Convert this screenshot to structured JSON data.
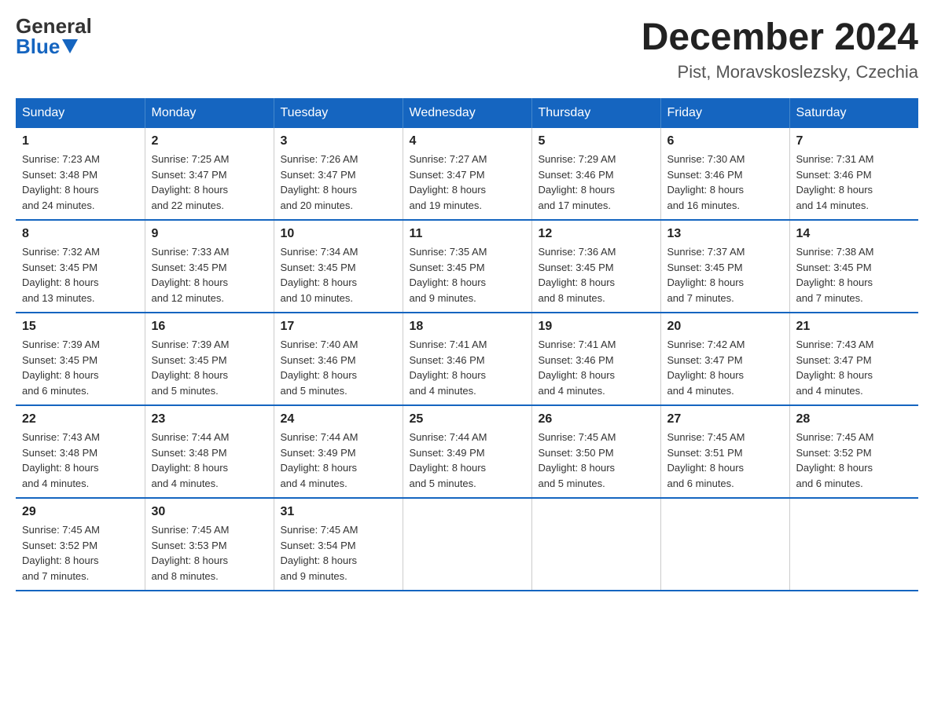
{
  "logo": {
    "general": "General",
    "blue": "Blue"
  },
  "title": {
    "month_year": "December 2024",
    "location": "Pist, Moravskoslezsky, Czechia"
  },
  "headers": [
    "Sunday",
    "Monday",
    "Tuesday",
    "Wednesday",
    "Thursday",
    "Friday",
    "Saturday"
  ],
  "weeks": [
    [
      {
        "day": "1",
        "sunrise": "7:23 AM",
        "sunset": "3:48 PM",
        "daylight": "8 hours and 24 minutes."
      },
      {
        "day": "2",
        "sunrise": "7:25 AM",
        "sunset": "3:47 PM",
        "daylight": "8 hours and 22 minutes."
      },
      {
        "day": "3",
        "sunrise": "7:26 AM",
        "sunset": "3:47 PM",
        "daylight": "8 hours and 20 minutes."
      },
      {
        "day": "4",
        "sunrise": "7:27 AM",
        "sunset": "3:47 PM",
        "daylight": "8 hours and 19 minutes."
      },
      {
        "day": "5",
        "sunrise": "7:29 AM",
        "sunset": "3:46 PM",
        "daylight": "8 hours and 17 minutes."
      },
      {
        "day": "6",
        "sunrise": "7:30 AM",
        "sunset": "3:46 PM",
        "daylight": "8 hours and 16 minutes."
      },
      {
        "day": "7",
        "sunrise": "7:31 AM",
        "sunset": "3:46 PM",
        "daylight": "8 hours and 14 minutes."
      }
    ],
    [
      {
        "day": "8",
        "sunrise": "7:32 AM",
        "sunset": "3:45 PM",
        "daylight": "8 hours and 13 minutes."
      },
      {
        "day": "9",
        "sunrise": "7:33 AM",
        "sunset": "3:45 PM",
        "daylight": "8 hours and 12 minutes."
      },
      {
        "day": "10",
        "sunrise": "7:34 AM",
        "sunset": "3:45 PM",
        "daylight": "8 hours and 10 minutes."
      },
      {
        "day": "11",
        "sunrise": "7:35 AM",
        "sunset": "3:45 PM",
        "daylight": "8 hours and 9 minutes."
      },
      {
        "day": "12",
        "sunrise": "7:36 AM",
        "sunset": "3:45 PM",
        "daylight": "8 hours and 8 minutes."
      },
      {
        "day": "13",
        "sunrise": "7:37 AM",
        "sunset": "3:45 PM",
        "daylight": "8 hours and 7 minutes."
      },
      {
        "day": "14",
        "sunrise": "7:38 AM",
        "sunset": "3:45 PM",
        "daylight": "8 hours and 7 minutes."
      }
    ],
    [
      {
        "day": "15",
        "sunrise": "7:39 AM",
        "sunset": "3:45 PM",
        "daylight": "8 hours and 6 minutes."
      },
      {
        "day": "16",
        "sunrise": "7:39 AM",
        "sunset": "3:45 PM",
        "daylight": "8 hours and 5 minutes."
      },
      {
        "day": "17",
        "sunrise": "7:40 AM",
        "sunset": "3:46 PM",
        "daylight": "8 hours and 5 minutes."
      },
      {
        "day": "18",
        "sunrise": "7:41 AM",
        "sunset": "3:46 PM",
        "daylight": "8 hours and 4 minutes."
      },
      {
        "day": "19",
        "sunrise": "7:41 AM",
        "sunset": "3:46 PM",
        "daylight": "8 hours and 4 minutes."
      },
      {
        "day": "20",
        "sunrise": "7:42 AM",
        "sunset": "3:47 PM",
        "daylight": "8 hours and 4 minutes."
      },
      {
        "day": "21",
        "sunrise": "7:43 AM",
        "sunset": "3:47 PM",
        "daylight": "8 hours and 4 minutes."
      }
    ],
    [
      {
        "day": "22",
        "sunrise": "7:43 AM",
        "sunset": "3:48 PM",
        "daylight": "8 hours and 4 minutes."
      },
      {
        "day": "23",
        "sunrise": "7:44 AM",
        "sunset": "3:48 PM",
        "daylight": "8 hours and 4 minutes."
      },
      {
        "day": "24",
        "sunrise": "7:44 AM",
        "sunset": "3:49 PM",
        "daylight": "8 hours and 4 minutes."
      },
      {
        "day": "25",
        "sunrise": "7:44 AM",
        "sunset": "3:49 PM",
        "daylight": "8 hours and 5 minutes."
      },
      {
        "day": "26",
        "sunrise": "7:45 AM",
        "sunset": "3:50 PM",
        "daylight": "8 hours and 5 minutes."
      },
      {
        "day": "27",
        "sunrise": "7:45 AM",
        "sunset": "3:51 PM",
        "daylight": "8 hours and 6 minutes."
      },
      {
        "day": "28",
        "sunrise": "7:45 AM",
        "sunset": "3:52 PM",
        "daylight": "8 hours and 6 minutes."
      }
    ],
    [
      {
        "day": "29",
        "sunrise": "7:45 AM",
        "sunset": "3:52 PM",
        "daylight": "8 hours and 7 minutes."
      },
      {
        "day": "30",
        "sunrise": "7:45 AM",
        "sunset": "3:53 PM",
        "daylight": "8 hours and 8 minutes."
      },
      {
        "day": "31",
        "sunrise": "7:45 AM",
        "sunset": "3:54 PM",
        "daylight": "8 hours and 9 minutes."
      },
      null,
      null,
      null,
      null
    ]
  ],
  "labels": {
    "sunrise": "Sunrise:",
    "sunset": "Sunset:",
    "daylight": "Daylight:"
  }
}
